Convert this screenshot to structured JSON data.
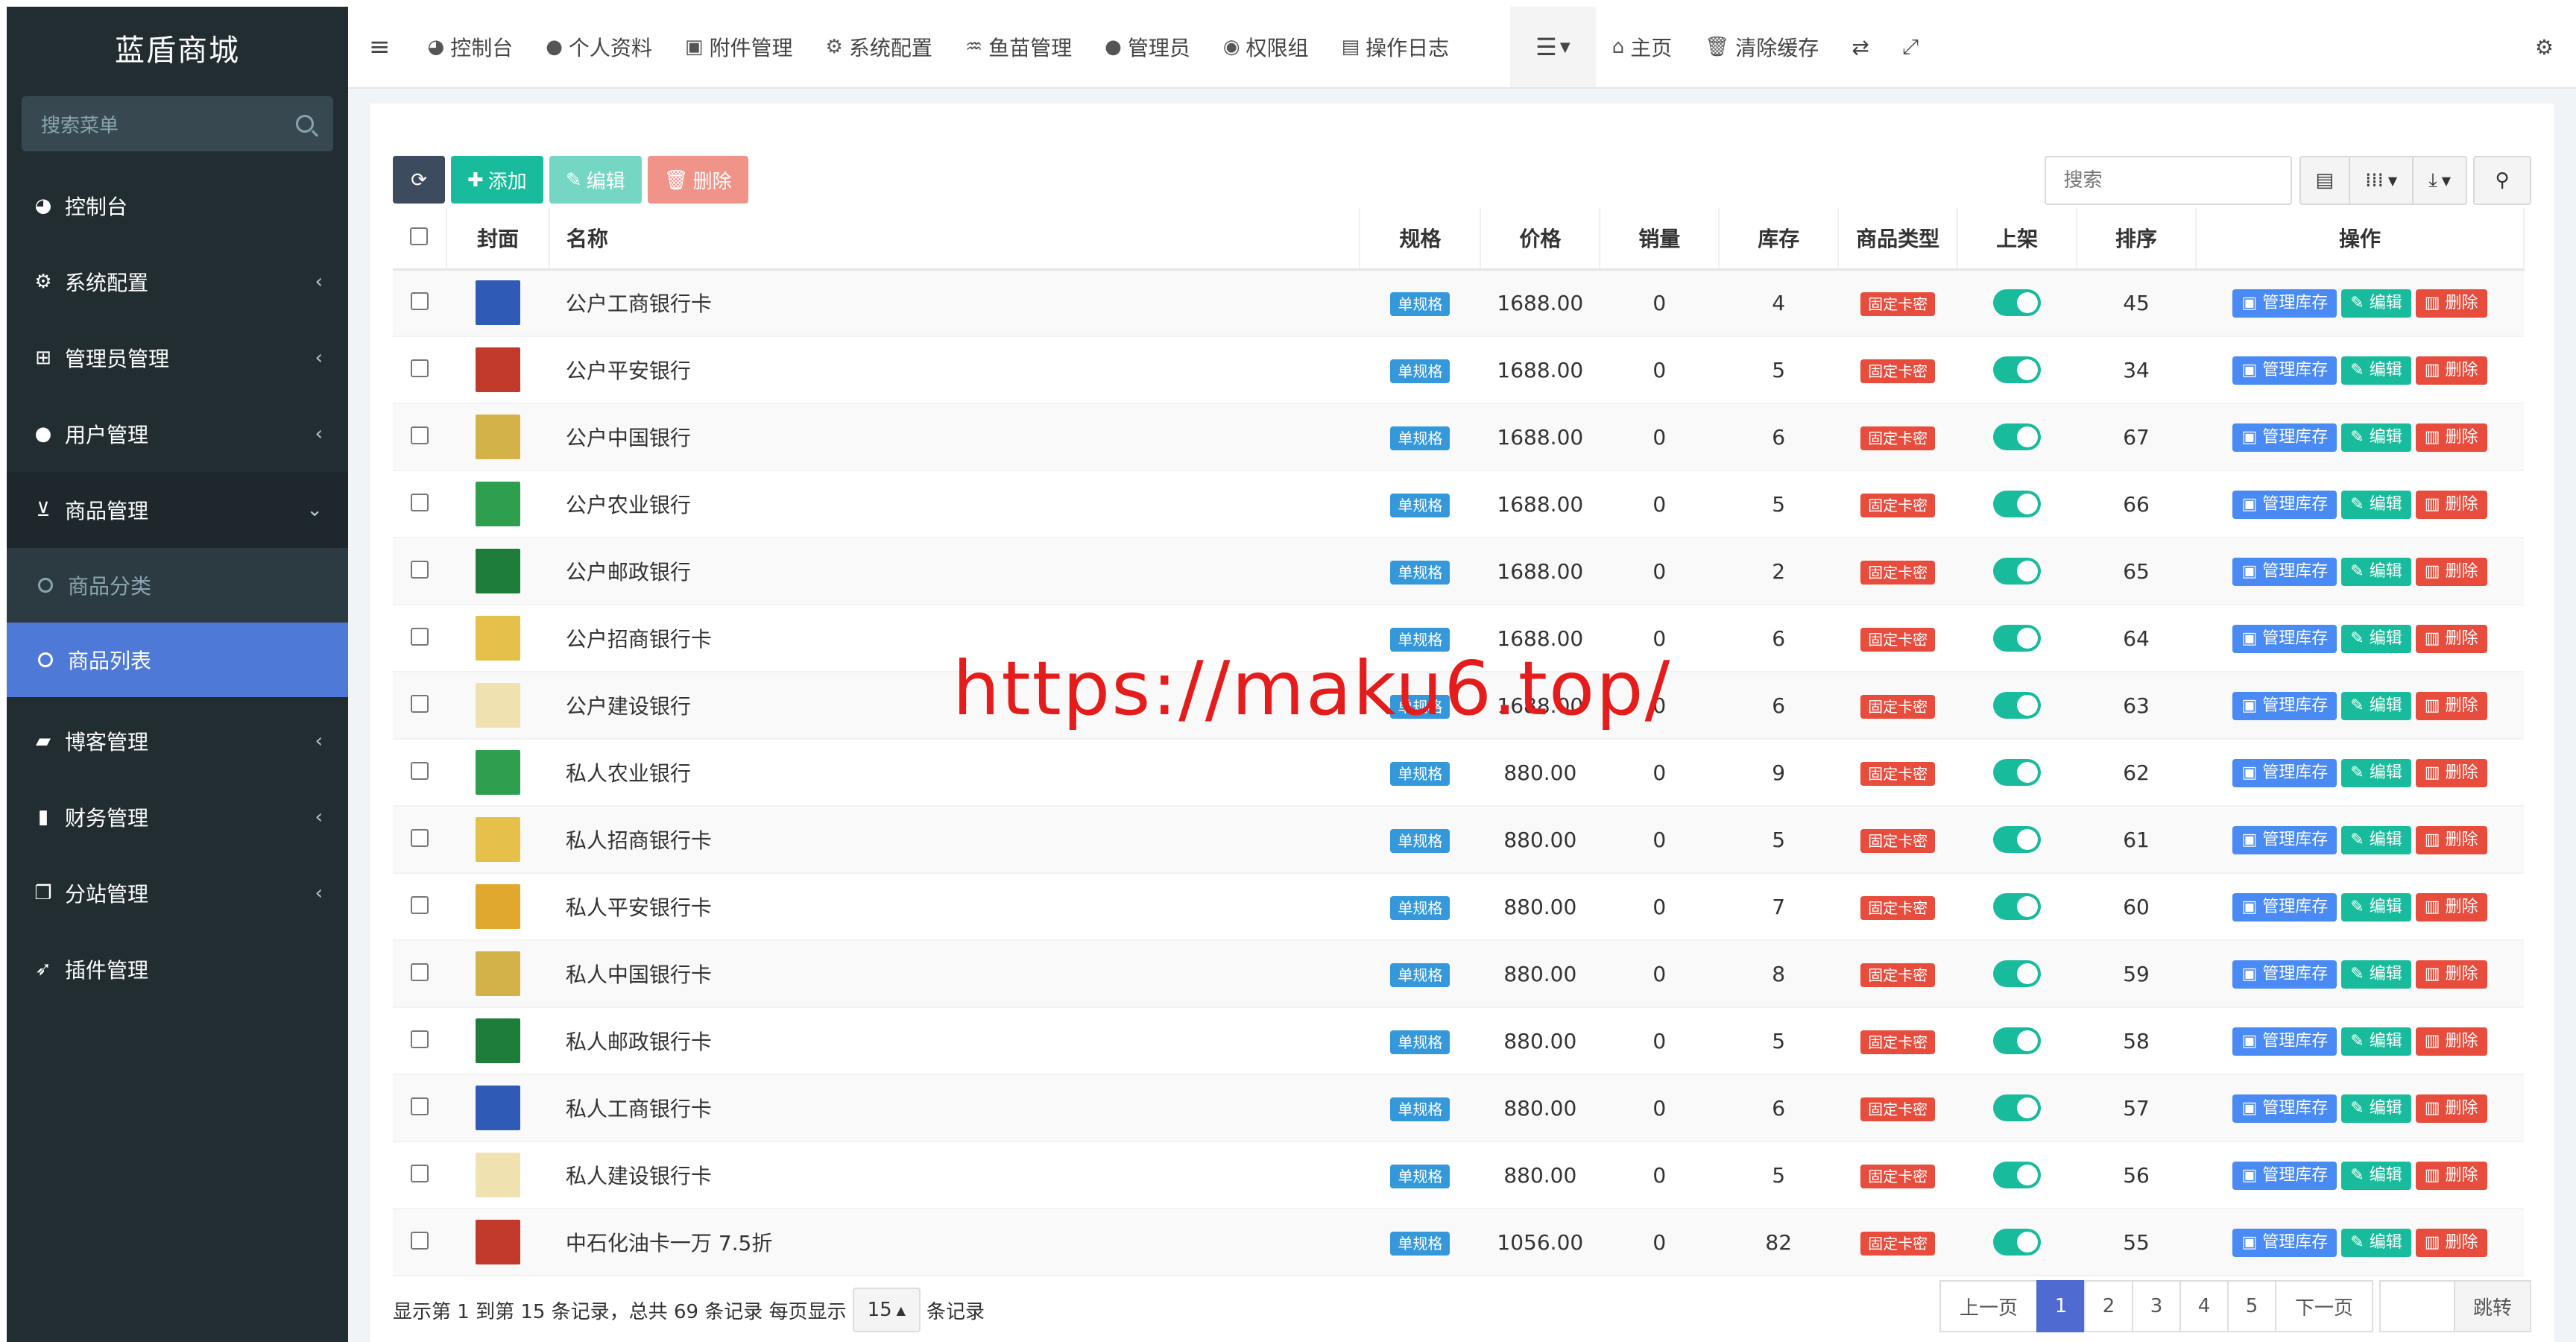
{
  "brand": "蓝盾商城",
  "sidebar": {
    "search_placeholder": "搜索菜单",
    "items": [
      {
        "label": "控制台",
        "icon": "dashboard-icon",
        "glyph": "◕"
      },
      {
        "label": "系统配置",
        "icon": "cogs-icon",
        "glyph": "⚙"
      },
      {
        "label": "管理员管理",
        "icon": "windows-icon",
        "glyph": "⊞"
      },
      {
        "label": "用户管理",
        "icon": "user-icon",
        "glyph": "●"
      },
      {
        "label": "商品管理",
        "icon": "shopping-cart-icon",
        "glyph": "⊻"
      },
      {
        "label": "博客管理",
        "icon": "book-icon",
        "glyph": "▰"
      },
      {
        "label": "财务管理",
        "icon": "bookmark-icon",
        "glyph": "▮"
      },
      {
        "label": "分站管理",
        "icon": "window-restore-icon",
        "glyph": "❐"
      },
      {
        "label": "插件管理",
        "icon": "rocket-icon",
        "glyph": "➶"
      }
    ],
    "sub_items": [
      {
        "label": "商品分类"
      },
      {
        "label": "商品列表"
      }
    ]
  },
  "navbar": {
    "items": [
      {
        "label": "控制台",
        "icon": "dashboard-icon",
        "glyph": "◕"
      },
      {
        "label": "个人资料",
        "icon": "user-icon",
        "glyph": "●"
      },
      {
        "label": "附件管理",
        "icon": "image-icon",
        "glyph": "▣"
      },
      {
        "label": "系统配置",
        "icon": "cog-icon",
        "glyph": "⚙"
      },
      {
        "label": "鱼苗管理",
        "icon": "fish-icon",
        "glyph": "♒"
      },
      {
        "label": "管理员",
        "icon": "user-icon",
        "glyph": "●"
      },
      {
        "label": "权限组",
        "icon": "group-icon",
        "glyph": "◉"
      },
      {
        "label": "操作日志",
        "icon": "list-alt-icon",
        "glyph": "▤"
      }
    ],
    "home": "主页",
    "clear_cache": "清除缓存"
  },
  "toolbar": {
    "add": "添加",
    "edit": "编辑",
    "delete": "删除",
    "search_placeholder": "搜索"
  },
  "table": {
    "headers": [
      "封面",
      "名称",
      "规格",
      "价格",
      "销量",
      "库存",
      "商品类型",
      "上架",
      "排序",
      "操作"
    ],
    "spec_label": "单规格",
    "type_label": "固定卡密",
    "op_stock": "管理库存",
    "op_edit": "编辑",
    "op_delete": "删除",
    "rows": [
      {
        "name": "公户工商银行卡",
        "price": "1688.00",
        "sales": "0",
        "stock": "4",
        "sort": "45",
        "cover": "#2f5bb7"
      },
      {
        "name": "公户平安银行",
        "price": "1688.00",
        "sales": "0",
        "stock": "5",
        "sort": "34",
        "cover": "#c0392b"
      },
      {
        "name": "公户中国银行",
        "price": "1688.00",
        "sales": "0",
        "stock": "6",
        "sort": "67",
        "cover": "#d4b24a"
      },
      {
        "name": "公户农业银行",
        "price": "1688.00",
        "sales": "0",
        "stock": "5",
        "sort": "66",
        "cover": "#2e9e4f"
      },
      {
        "name": "公户邮政银行",
        "price": "1688.00",
        "sales": "0",
        "stock": "2",
        "sort": "65",
        "cover": "#1e7d3a"
      },
      {
        "name": "公户招商银行卡",
        "price": "1688.00",
        "sales": "0",
        "stock": "6",
        "sort": "64",
        "cover": "#e5c04a"
      },
      {
        "name": "公户建设银行",
        "price": "1688.00",
        "sales": "0",
        "stock": "6",
        "sort": "63",
        "cover": "#efe2b0"
      },
      {
        "name": "私人农业银行",
        "price": "880.00",
        "sales": "0",
        "stock": "9",
        "sort": "62",
        "cover": "#2e9e4f"
      },
      {
        "name": "私人招商银行卡",
        "price": "880.00",
        "sales": "0",
        "stock": "5",
        "sort": "61",
        "cover": "#e5c04a"
      },
      {
        "name": "私人平安银行卡",
        "price": "880.00",
        "sales": "0",
        "stock": "7",
        "sort": "60",
        "cover": "#e0a82e"
      },
      {
        "name": "私人中国银行卡",
        "price": "880.00",
        "sales": "0",
        "stock": "8",
        "sort": "59",
        "cover": "#d4b24a"
      },
      {
        "name": "私人邮政银行卡",
        "price": "880.00",
        "sales": "0",
        "stock": "5",
        "sort": "58",
        "cover": "#1e7d3a"
      },
      {
        "name": "私人工商银行卡",
        "price": "880.00",
        "sales": "0",
        "stock": "6",
        "sort": "57",
        "cover": "#2f5bb7"
      },
      {
        "name": "私人建设银行卡",
        "price": "880.00",
        "sales": "0",
        "stock": "5",
        "sort": "56",
        "cover": "#efe2b0"
      },
      {
        "name": "中石化油卡一万 7.5折",
        "price": "1056.00",
        "sales": "0",
        "stock": "82",
        "sort": "55",
        "cover": "#c0392b"
      }
    ]
  },
  "footer": {
    "info_prefix": "显示第 1 到第 15 条记录，总共 69 条记录 每页显示",
    "page_size": "15",
    "info_suffix": "条记录",
    "prev": "上一页",
    "next": "下一页",
    "pages": [
      "1",
      "2",
      "3",
      "4",
      "5"
    ],
    "go": "跳转"
  },
  "watermark": "https://maku6.top/",
  "colors": {
    "sidebar_bg": "#222d32",
    "active_menu": "#4e6bd1",
    "success": "#18bc9c",
    "danger": "#e74c3c",
    "primary": "#4a8af4"
  }
}
